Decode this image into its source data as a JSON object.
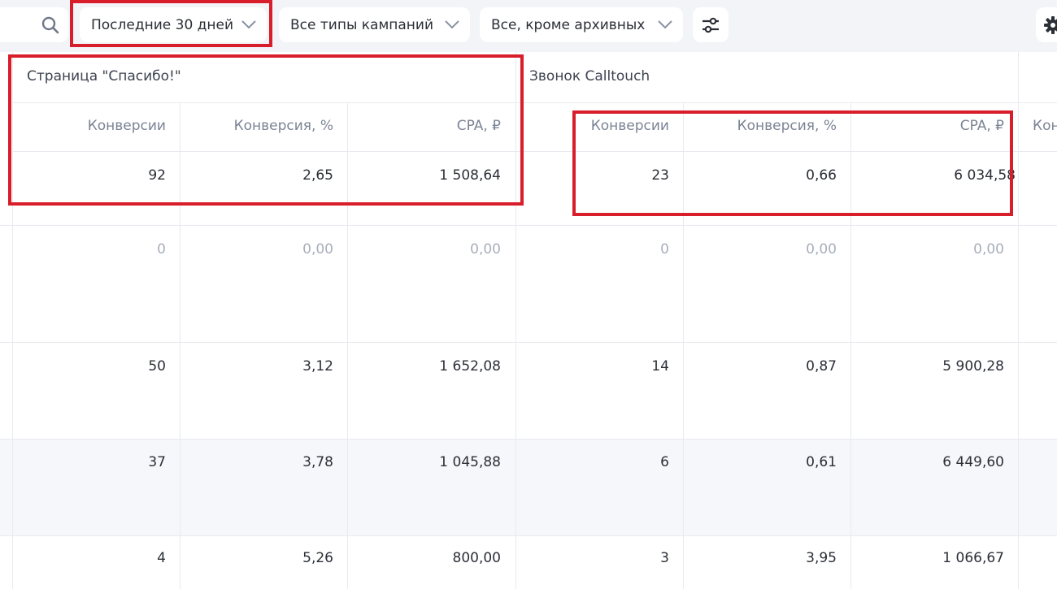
{
  "toolbar": {
    "period_label": "Последние 30 дней",
    "campaign_types_label": "Все типы кампаний",
    "archive_filter_label": "Все, кроме архивных"
  },
  "groups": [
    {
      "title": "Страница \"Спасибо!\"",
      "columns": [
        "Конверсии",
        "Конверсия, %",
        "CPA, ₽"
      ]
    },
    {
      "title": "Звонок Calltouch",
      "columns": [
        "Конверсии",
        "Конверсия, %",
        "CPA, ₽"
      ]
    }
  ],
  "next_group_partial_header": "Кон",
  "rows": [
    [
      "92",
      "2,65",
      "1 508,64",
      "23",
      "0,66",
      "6 034,58"
    ],
    [
      "0",
      "0,00",
      "0,00",
      "0",
      "0,00",
      "0,00"
    ],
    [
      "50",
      "3,12",
      "1 652,08",
      "14",
      "0,87",
      "5 900,28"
    ],
    [
      "37",
      "3,78",
      "1 045,88",
      "6",
      "0,61",
      "6 449,60"
    ],
    [
      "4",
      "5,26",
      "800,00",
      "3",
      "3,95",
      "1 066,67"
    ]
  ],
  "colors": {
    "highlight": "#d81e2a",
    "toolbar_bg": "#f3f4f8",
    "muted_text": "#a8afbb"
  }
}
